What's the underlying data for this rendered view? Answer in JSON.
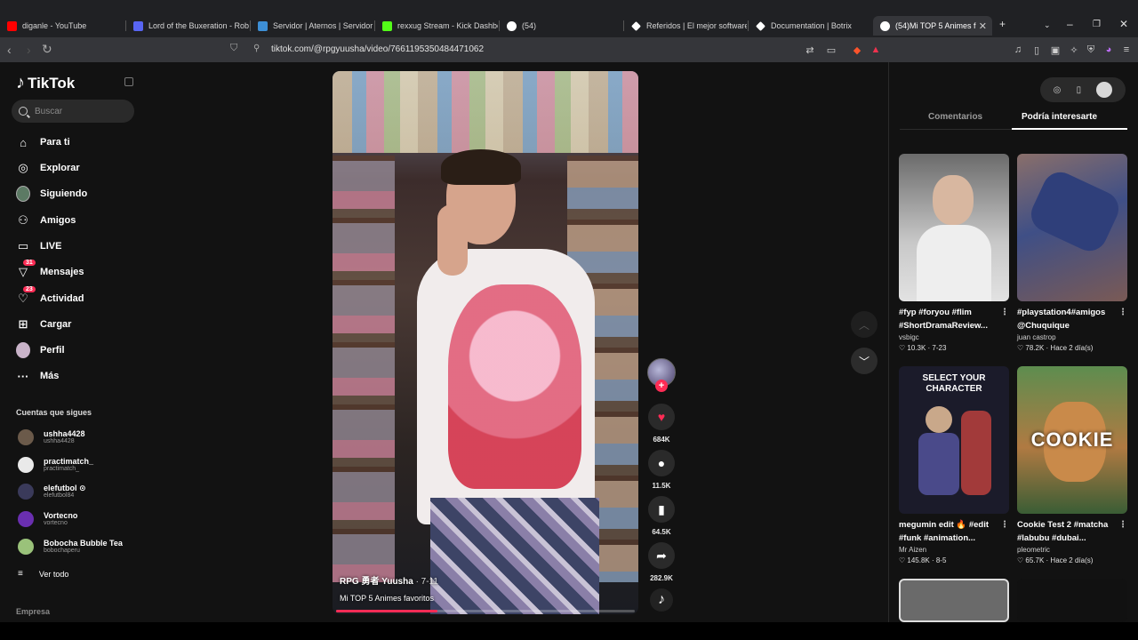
{
  "browser": {
    "tabs": [
      {
        "title": "diganle - YouTube",
        "color": "#ff0000"
      },
      {
        "title": "Lord of the Buxeration - Roblo",
        "color": "#5865f2"
      },
      {
        "title": "Servidor | Aternos | Servidor de",
        "color": "#3d8fd6"
      },
      {
        "title": "rexxug Stream - Kick Dashboa",
        "color": "#53fc18"
      },
      {
        "title": "(54)",
        "color": "#ffffff"
      },
      {
        "title": "Referidos | El mejor software p",
        "color": "#ffffff"
      },
      {
        "title": "Documentation | Botrix",
        "color": "#ffffff"
      },
      {
        "title": "(54)Mi TOP 5 Animes f",
        "color": "#ffffff"
      }
    ],
    "new_tab": "+",
    "url": "tiktok.com/@rpgyuusha/video/7661195350484471062"
  },
  "tiktok": {
    "logo": "TikTok",
    "search_placeholder": "Buscar",
    "nav": [
      {
        "label": "Para ti",
        "icon": "home-icon",
        "glyph": "⌂"
      },
      {
        "label": "Explorar",
        "icon": "compass-icon",
        "glyph": "◎"
      },
      {
        "label": "Siguiendo",
        "icon": "following-avatar-icon",
        "glyph": ""
      },
      {
        "label": "Amigos",
        "icon": "friends-icon",
        "glyph": "👥"
      },
      {
        "label": "LIVE",
        "icon": "live-icon",
        "glyph": "▭"
      },
      {
        "label": "Mensajes",
        "icon": "messages-icon",
        "glyph": "▽",
        "badge": "31"
      },
      {
        "label": "Actividad",
        "icon": "activity-icon",
        "glyph": "♡",
        "badge": "23"
      },
      {
        "label": "Cargar",
        "icon": "upload-icon",
        "glyph": "⊞"
      },
      {
        "label": "Perfil",
        "icon": "profile-avatar-icon",
        "glyph": ""
      },
      {
        "label": "Más",
        "icon": "more-icon",
        "glyph": "···"
      }
    ],
    "following_title": "Cuentas que sigues",
    "following": [
      {
        "name": "ushha4428",
        "handle": "ushha4428",
        "color": "#6b5a4a"
      },
      {
        "name": "practimatch_",
        "handle": "practimatch_",
        "color": "#e9e9e9"
      },
      {
        "name": "elefutbol ⊙",
        "handle": "elefutbol84",
        "color": "#3a3a5a"
      },
      {
        "name": "Vortecno",
        "handle": "vortecno",
        "color": "#6a2fb0"
      },
      {
        "name": "Bobocha Bubble Tea",
        "handle": "bobochaperu",
        "color": "#9ac27a"
      }
    ],
    "see_all": "Ver todo",
    "empresa": "Empresa"
  },
  "video": {
    "author": "RPG 勇者 Yuusha",
    "date": "· 7-11",
    "caption": "Mi TOP 5 Animes favoritos",
    "progress": 0.34,
    "likes": "684K",
    "comments": "11.5K",
    "saves": "64.5K",
    "shares": "282.9K"
  },
  "right_panel": {
    "tab_comments": "Comentarios",
    "tab_interest": "Podría interesarte",
    "cards": [
      {
        "title": "#fyp #foryou #flim #ShortDramaReview...",
        "author": "vsbigc",
        "meta": "♡ 10.3K · 7-23",
        "bg": "#5a5a5a",
        "thumb_text": ""
      },
      {
        "title": "#playstation4#amigos @Chuquique",
        "author": "juan castrop",
        "meta": "♡ 78.2K · Hace 2 día(s)",
        "bg": "#3f4f86",
        "thumb_text": ""
      },
      {
        "title": "megumin edit 🔥 #edit #funk #animation...",
        "author": "Mr Aizen",
        "meta": "♡ 145.8K · 8-5",
        "bg": "#1b1b2a",
        "thumb_text": "SELECT YOUR CHARACTER"
      },
      {
        "title": "Cookie Test 2 #matcha #labubu #dubai...",
        "author": "pleometric",
        "meta": "♡ 65.7K · Hace 2 día(s)",
        "bg": "#4f8d4f",
        "thumb_text": "COOKIE"
      }
    ]
  }
}
